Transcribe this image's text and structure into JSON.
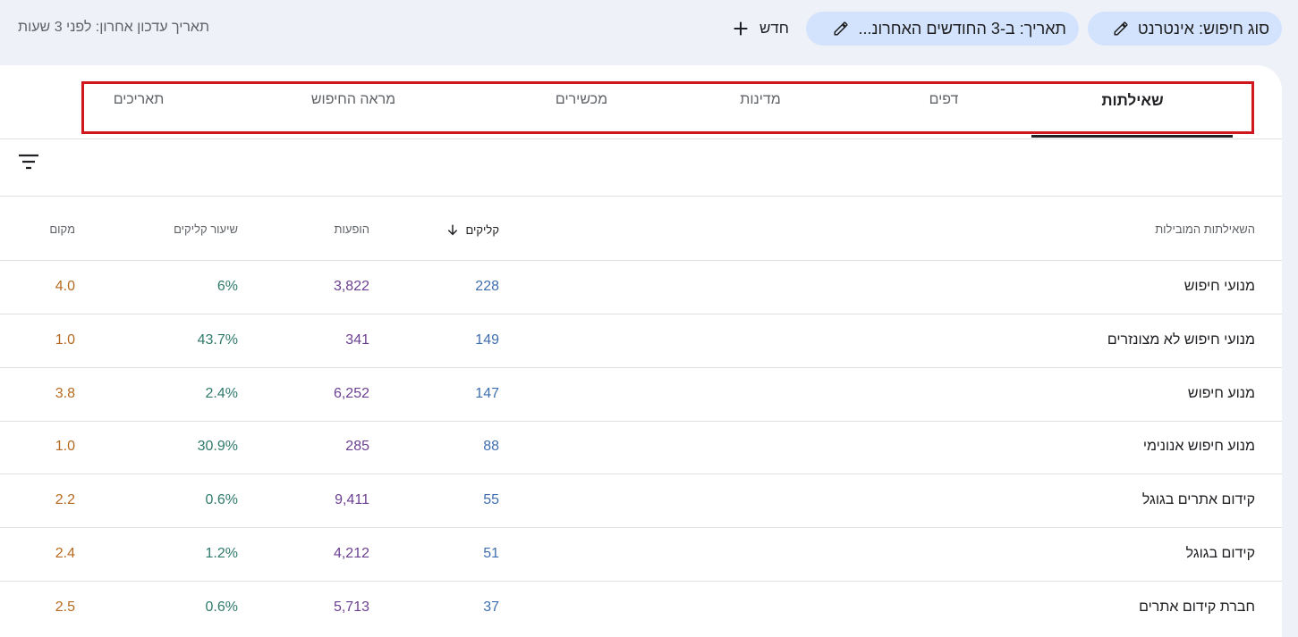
{
  "topbar": {
    "search_type_chip": "סוג חיפוש: אינטרנט",
    "date_chip": "תאריך: ב-3 החודשים האחרונ...",
    "new_label": "חדש",
    "last_update": "תאריך עדכון אחרון: לפני 3 שעות"
  },
  "tabs": [
    {
      "label": "שאילתות",
      "active": true
    },
    {
      "label": "דפים",
      "active": false
    },
    {
      "label": "מדינות",
      "active": false
    },
    {
      "label": "מכשירים",
      "active": false
    },
    {
      "label": "מראה החיפוש",
      "active": false
    },
    {
      "label": "תאריכים",
      "active": false
    }
  ],
  "table": {
    "headers": {
      "query": "השאילתות המובילות",
      "clicks": "קליקים",
      "impressions": "הופעות",
      "ctr": "שיעור קליקים",
      "position": "מקום"
    },
    "rows": [
      {
        "query": "מנועי חיפוש",
        "clicks": "228",
        "impressions": "3,822",
        "ctr": "6%",
        "position": "4.0"
      },
      {
        "query": "מנועי חיפוש לא מצונזרים",
        "clicks": "149",
        "impressions": "341",
        "ctr": "43.7%",
        "position": "1.0"
      },
      {
        "query": "מנוע חיפוש",
        "clicks": "147",
        "impressions": "6,252",
        "ctr": "2.4%",
        "position": "3.8"
      },
      {
        "query": "מנוע חיפוש אנונימי",
        "clicks": "88",
        "impressions": "285",
        "ctr": "30.9%",
        "position": "1.0"
      },
      {
        "query": "קידום אתרים בגוגל",
        "clicks": "55",
        "impressions": "9,411",
        "ctr": "0.6%",
        "position": "2.2"
      },
      {
        "query": "קידום בגוגל",
        "clicks": "51",
        "impressions": "4,212",
        "ctr": "1.2%",
        "position": "2.4"
      },
      {
        "query": "חברת קידום אתרים",
        "clicks": "37",
        "impressions": "5,713",
        "ctr": "0.6%",
        "position": "2.5"
      }
    ]
  },
  "icons": {
    "edit": "pencil-icon",
    "add": "plus-icon",
    "filter": "filter-lines-icon",
    "sort": "arrow-down-icon"
  },
  "colors": {
    "clicks": "#3f6eb0",
    "impressions": "#6b3f91",
    "ctr": "#2f7a6b",
    "position": "#b66a1f",
    "highlight": "#d0161e",
    "chip": "#d3e3fd"
  }
}
